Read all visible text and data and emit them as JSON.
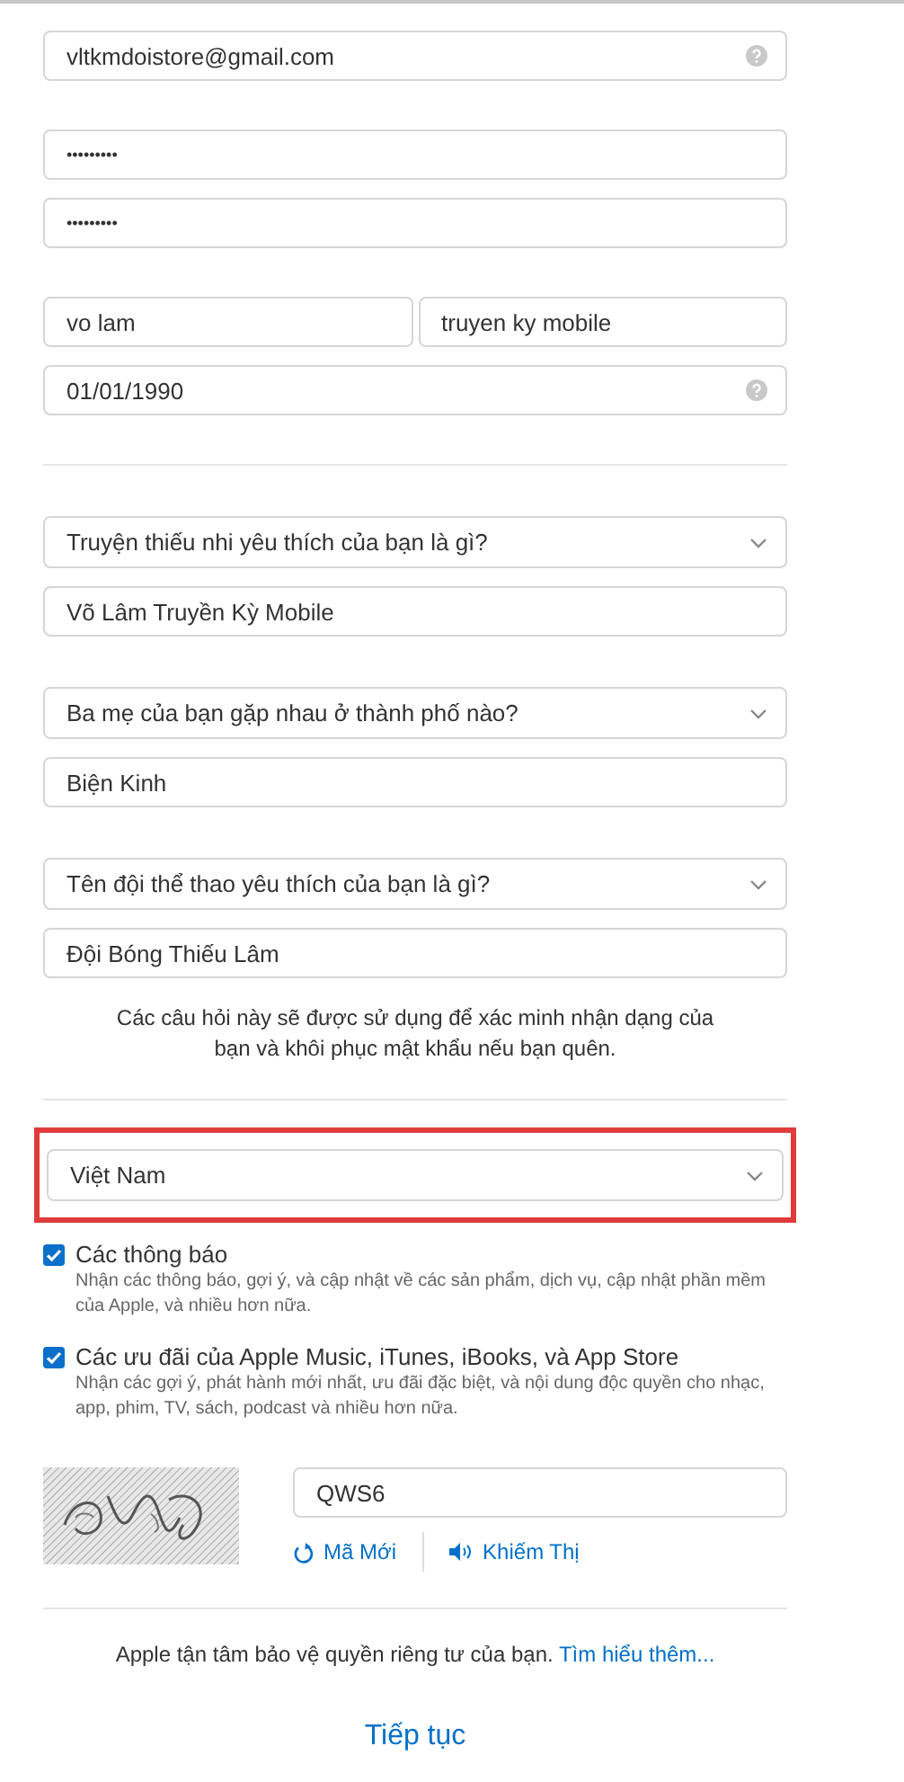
{
  "account_groups": [
    [
      [
        {
          "kind": "text",
          "value": "vltkmdoistore@gmail.com",
          "help": true
        }
      ]
    ],
    [
      [
        {
          "kind": "password",
          "value": "•••••••••",
          "help": false
        }
      ],
      [
        {
          "kind": "password",
          "value": "•••••••••",
          "help": false
        }
      ]
    ],
    [
      [
        {
          "kind": "text",
          "value": "vo lam",
          "help": false
        },
        {
          "kind": "text",
          "value": "truyen ky mobile",
          "help": false
        }
      ],
      [
        {
          "kind": "text",
          "value": "01/01/1990",
          "help": true
        }
      ]
    ]
  ],
  "security_questions": [
    {
      "question": "Truyện thiếu nhi yêu thích của bạn là gì?",
      "answer": "Võ Lâm Truyền Kỳ Mobile"
    },
    {
      "question": "Ba mẹ của bạn gặp nhau ở thành phố nào?",
      "answer": "Biện Kinh"
    },
    {
      "question": "Tên đội thể thao yêu thích của bạn là gì?",
      "answer": "Đội Bóng Thiếu Lâm"
    }
  ],
  "security_note": "Các câu hỏi này sẽ được sử dụng để xác minh nhận dạng của bạn và khôi phục mật khẩu nếu bạn quên.",
  "country": {
    "value": "Việt Nam",
    "highlighted": true
  },
  "subscriptions": [
    {
      "title": "Các thông báo",
      "description": "Nhận các thông báo, gợi ý, và cập nhật về các sản phẩm, dịch vụ, cập nhật phần mềm của Apple, và nhiều hơn nữa.",
      "checked": true
    },
    {
      "title": "Các ưu đãi của Apple Music, iTunes, iBooks, và App Store",
      "description": "Nhận các gợi ý, phát hành mới nhất, ưu đãi đặc biệt, và nội dung độc quyền cho nhạc, app, phim, TV, sách, podcast và nhiều hơn nữa.",
      "checked": true
    }
  ],
  "captcha": {
    "value": "QWS6",
    "refresh_label": "Mã Mới",
    "audio_label": "Khiếm Thị"
  },
  "privacy": {
    "text": "Apple tận tâm bảo vệ quyền riêng tư của bạn.",
    "link": "Tìm hiểu thêm..."
  },
  "continue_label": "Tiếp tục"
}
